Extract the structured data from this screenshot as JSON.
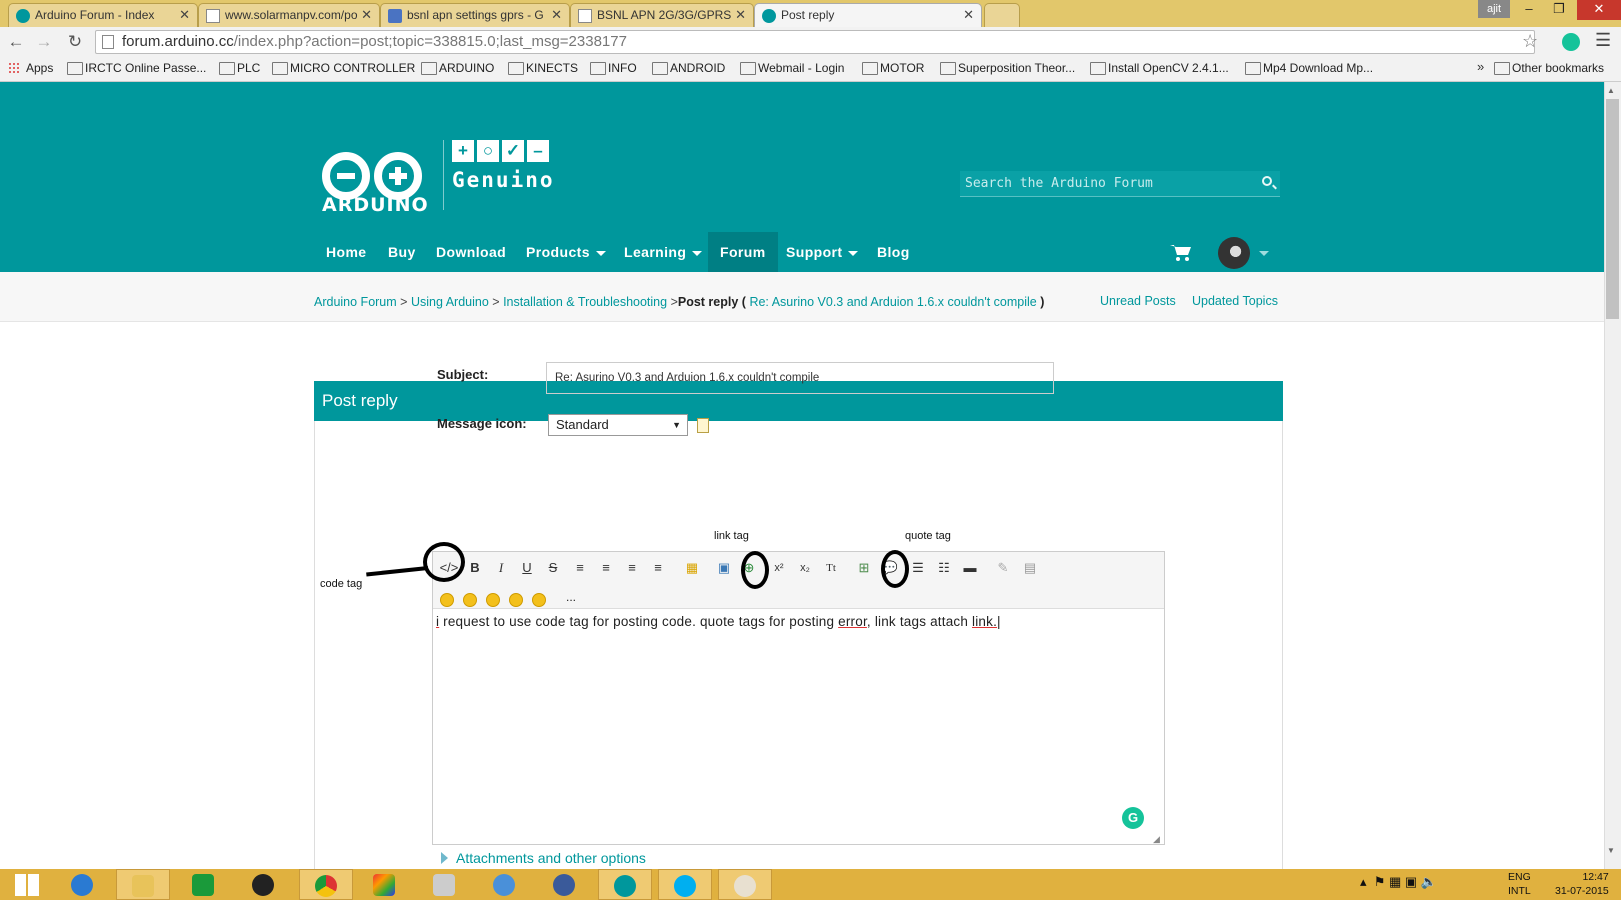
{
  "browser": {
    "tabs": [
      {
        "label": "Arduino Forum - Index",
        "icon": "arduino-icon"
      },
      {
        "label": "www.solarmanpv.com/po",
        "icon": "page-icon"
      },
      {
        "label": "bsnl apn settings gprs - G",
        "icon": "google-icon"
      },
      {
        "label": "BSNL APN 2G/3G/GPRS",
        "icon": "page-icon"
      },
      {
        "label": "Post reply",
        "icon": "arduino-icon",
        "active": true
      }
    ],
    "user": "ajit",
    "url_host": "forum.arduino.cc",
    "url_path": "/index.php?action=post;topic=338815.0;last_msg=2338177",
    "bookmarks": [
      "Apps",
      "IRCTC Online Passe...",
      "PLC",
      "MICRO CONTROLLER",
      "ARDUINO",
      "KINECTS",
      "INFO",
      "ANDROID",
      "Webmail - Login",
      "MOTOR",
      "Superposition Theor...",
      "Install OpenCV 2.4.1...",
      "Mp4 Download Mp..."
    ],
    "bookmarks_more": "»",
    "other_bookmarks": "Other bookmarks"
  },
  "site": {
    "logo_text": "ARDUINO",
    "genuino_text": "Genuino",
    "search_placeholder": "Search the Arduino Forum",
    "nav": [
      {
        "label": "Home"
      },
      {
        "label": "Buy"
      },
      {
        "label": "Download"
      },
      {
        "label": "Products",
        "dropdown": true
      },
      {
        "label": "Learning",
        "dropdown": true
      },
      {
        "label": "Forum",
        "active": true
      },
      {
        "label": "Support",
        "dropdown": true
      },
      {
        "label": "Blog"
      }
    ],
    "breadcrumb": {
      "c1": "Arduino Forum",
      "c2": "Using Arduino",
      "c3": "Installation & Troubleshooting",
      "current": "Post reply",
      "topic": "Re: Asurino V0.3 and Arduion 1.6.x couldn't compile",
      "sep": ">"
    },
    "unread": "Unread Posts",
    "updated": "Updated Topics"
  },
  "form": {
    "title": "Post reply",
    "subject_label": "Subject:",
    "subject_value": "Re: Asurino V0.3 and Arduion 1.6.x couldn't compile",
    "icon_label": "Message icon:",
    "icon_value": "Standard",
    "message_pre": "i",
    "message_mid": " request to use code tag for posting code. quote tags for posting ",
    "message_err": "error",
    "message_mid2": ", link tags attach ",
    "message_link": "link.",
    "attachments": "Attachments and other options",
    "more_smileys": "..."
  },
  "annotations": {
    "code_tag": "code tag",
    "link_tag": "link tag",
    "quote_tag": "quote tag"
  },
  "taskbar": {
    "lang": "ENG",
    "layout": "INTL",
    "time": "12:47",
    "date": "31-07-2015"
  },
  "colors": {
    "brand": "#00979c",
    "taskbar": "#e0b13f"
  }
}
